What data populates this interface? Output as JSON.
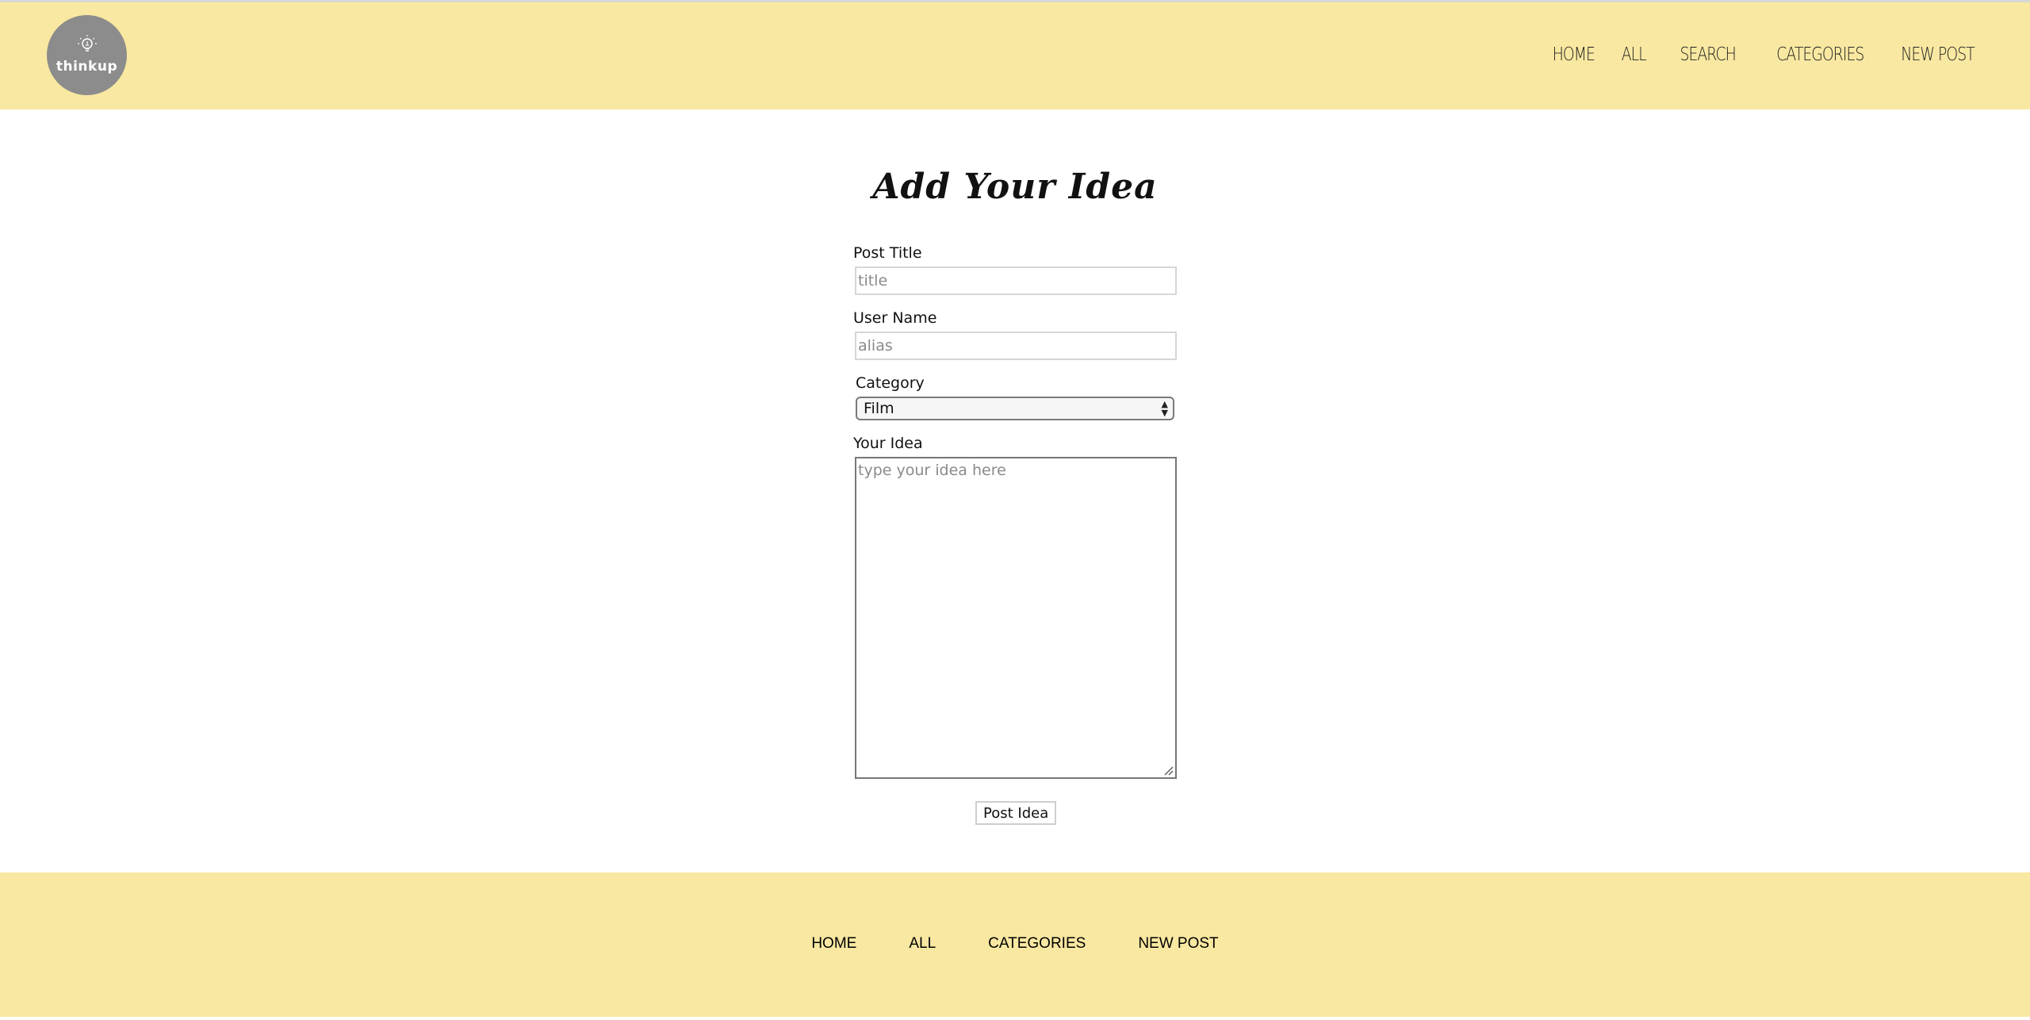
{
  "header": {
    "logo_text": "thinkup",
    "nav": [
      {
        "label": "HOME"
      },
      {
        "label": "ALL"
      },
      {
        "label": "SEARCH"
      },
      {
        "label": "CATEGORIES"
      },
      {
        "label": "NEW POST"
      }
    ]
  },
  "main": {
    "title": "Add Your Idea",
    "form": {
      "post_title_label": "Post Title",
      "post_title_placeholder": "title",
      "user_name_label": "User Name",
      "user_name_placeholder": "alias",
      "category_label": "Category",
      "category_selected": "Film",
      "idea_label": "Your Idea",
      "idea_placeholder": "type your idea here",
      "submit_label": "Post Idea"
    }
  },
  "footer": {
    "nav": [
      {
        "label": "HOME"
      },
      {
        "label": "ALL"
      },
      {
        "label": "CATEGORIES"
      },
      {
        "label": "NEW POST"
      }
    ]
  },
  "colors": {
    "header_bg": "#f9e8a1",
    "footer_bg": "#f9e8a1",
    "logo_bg": "#8c8c8c"
  }
}
